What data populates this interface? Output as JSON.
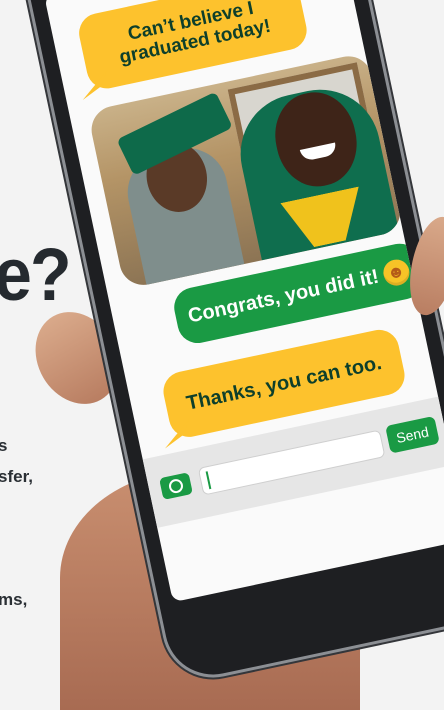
{
  "background": {
    "headline": "e?",
    "lines": [
      "s",
      "sfer,",
      "",
      "ms,"
    ]
  },
  "messages": [
    {
      "from": "graduate",
      "text_line1": "Can’t believe I",
      "text_line2": "graduated today!",
      "color": "#fdc22d"
    },
    {
      "from": "parent",
      "text": "Congrats, you did it!",
      "emoji": "smiling-face-emoji",
      "color": "#1a9a44"
    },
    {
      "from": "graduate",
      "text": "Thanks, you can too.",
      "color": "#fdc22d"
    }
  ],
  "composer": {
    "send_label": "Send",
    "input_value": ""
  },
  "colors": {
    "yellow": "#fdc22d",
    "green": "#1a9a44",
    "text_dark": "#0d3f2b"
  }
}
